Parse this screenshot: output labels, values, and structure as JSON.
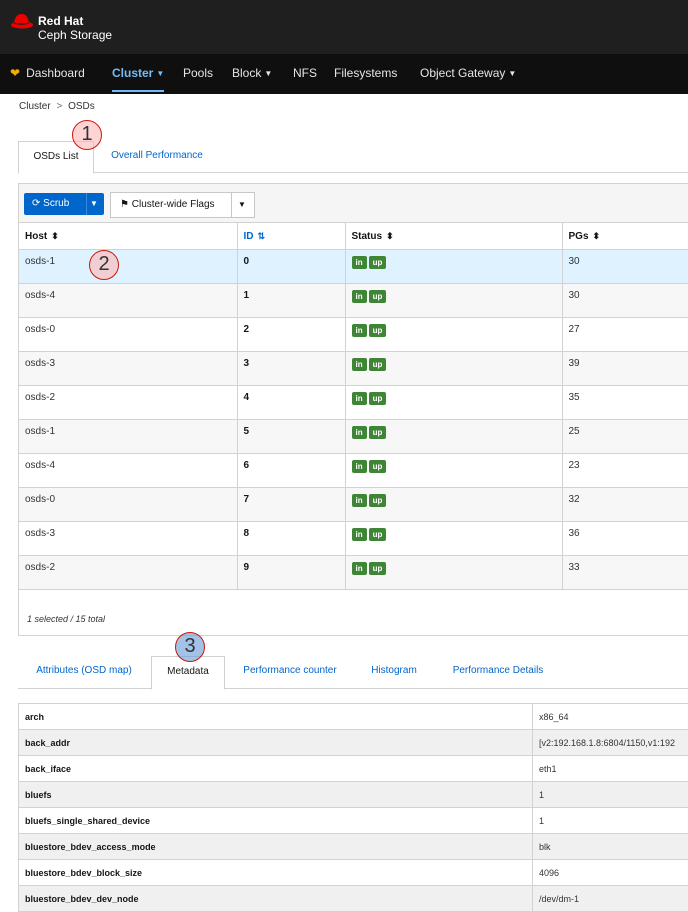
{
  "brand": {
    "line1": "Red Hat",
    "line2": "Ceph Storage"
  },
  "nav": {
    "dashboard": "Dashboard",
    "cluster": "Cluster",
    "pools": "Pools",
    "block": "Block",
    "nfs": "NFS",
    "filesystems": "Filesystems",
    "object_gateway": "Object Gateway"
  },
  "breadcrumb": {
    "parent": "Cluster",
    "separator": ">",
    "current": "OSDs"
  },
  "tabs": {
    "osds_list": "OSDs List",
    "overall_performance": "Overall Performance"
  },
  "toolbar": {
    "scrub": "Scrub",
    "cluster_flags": "Cluster-wide Flags"
  },
  "table": {
    "headers": {
      "host": "Host",
      "id": "ID",
      "status": "Status",
      "pgs": "PGs"
    },
    "rows": [
      {
        "host": "osds-1",
        "id": "0",
        "status_in": "in",
        "status_up": "up",
        "pgs": "30"
      },
      {
        "host": "osds-4",
        "id": "1",
        "status_in": "in",
        "status_up": "up",
        "pgs": "30"
      },
      {
        "host": "osds-0",
        "id": "2",
        "status_in": "in",
        "status_up": "up",
        "pgs": "27"
      },
      {
        "host": "osds-3",
        "id": "3",
        "status_in": "in",
        "status_up": "up",
        "pgs": "39"
      },
      {
        "host": "osds-2",
        "id": "4",
        "status_in": "in",
        "status_up": "up",
        "pgs": "35"
      },
      {
        "host": "osds-1",
        "id": "5",
        "status_in": "in",
        "status_up": "up",
        "pgs": "25"
      },
      {
        "host": "osds-4",
        "id": "6",
        "status_in": "in",
        "status_up": "up",
        "pgs": "23"
      },
      {
        "host": "osds-0",
        "id": "7",
        "status_in": "in",
        "status_up": "up",
        "pgs": "32"
      },
      {
        "host": "osds-3",
        "id": "8",
        "status_in": "in",
        "status_up": "up",
        "pgs": "36"
      },
      {
        "host": "osds-2",
        "id": "9",
        "status_in": "in",
        "status_up": "up",
        "pgs": "33"
      }
    ],
    "footer": "1 selected / 15 total"
  },
  "detail_tabs": {
    "attributes": "Attributes (OSD map)",
    "metadata": "Metadata",
    "perf_counter": "Performance counter",
    "histogram": "Histogram",
    "perf_details": "Performance Details"
  },
  "metadata": [
    {
      "key": "arch",
      "value": "x86_64"
    },
    {
      "key": "back_addr",
      "value": "[v2:192.168.1.8:6804/1150,v1:192"
    },
    {
      "key": "back_iface",
      "value": "eth1"
    },
    {
      "key": "bluefs",
      "value": "1"
    },
    {
      "key": "bluefs_single_shared_device",
      "value": "1"
    },
    {
      "key": "bluestore_bdev_access_mode",
      "value": "blk"
    },
    {
      "key": "bluestore_bdev_block_size",
      "value": "4096"
    },
    {
      "key": "bluestore_bdev_dev_node",
      "value": "/dev/dm-1"
    }
  ],
  "markers": [
    "1",
    "2",
    "3"
  ],
  "colors": {
    "primary": "#0066cc",
    "status_green": "#3e8635",
    "selected_row": "#def3ff",
    "nav_active": "#73bcf7",
    "brand_red": "#ee0000"
  }
}
